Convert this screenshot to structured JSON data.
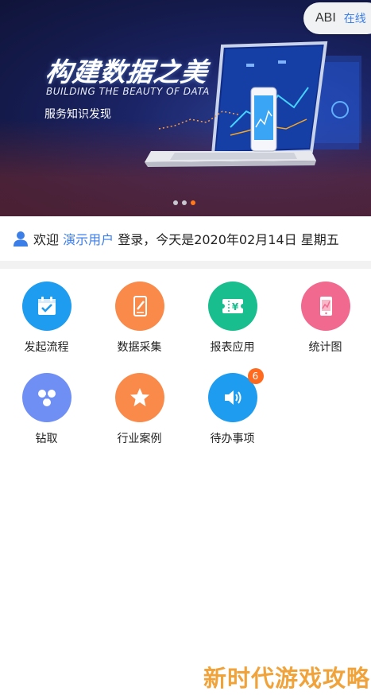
{
  "banner": {
    "title": "构建数据之美",
    "subtitle_en": "BUILDING THE BEAUTY OF DATA",
    "subtitle_cn": "服务知识发现",
    "carousel_count": 3,
    "carousel_active_index": 2
  },
  "app_pill": {
    "name": "ABI",
    "status": "在线"
  },
  "welcome": {
    "prefix": "欢迎 ",
    "user": "演示用户",
    "suffix": " 登录，今天是2020年02月14日 星期五"
  },
  "grid": {
    "items": [
      {
        "label": "发起流程",
        "icon": "calendar-check-icon",
        "color": "#1e9cf0"
      },
      {
        "label": "数据采集",
        "icon": "edit-phone-icon",
        "color": "#fa8a4a"
      },
      {
        "label": "报表应用",
        "icon": "yen-ticket-icon",
        "color": "#19be8f"
      },
      {
        "label": "统计图",
        "icon": "chart-phone-icon",
        "color": "#f2698f"
      },
      {
        "label": "钻取",
        "icon": "drill-network-icon",
        "color": "#6f8ff5"
      },
      {
        "label": "行业案例",
        "icon": "star-icon",
        "color": "#fa8a4a"
      },
      {
        "label": "待办事项",
        "icon": "speaker-icon",
        "color": "#1e9cf0",
        "badge": "6"
      }
    ]
  },
  "watermark": "新时代游戏攻略"
}
